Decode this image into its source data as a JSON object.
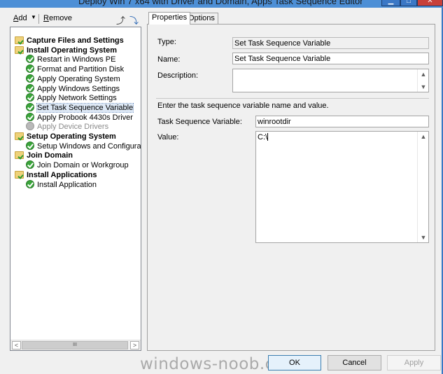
{
  "window": {
    "title": "Deploy Win 7 x64 with Driver and Domain, Apps Task Sequence Editor",
    "controls": [
      "minimize-icon",
      "maximize-icon",
      "close-icon"
    ]
  },
  "toolbar": {
    "add_label": "Add",
    "remove_label": "Remove"
  },
  "tree": {
    "items": [
      {
        "label": "Capture Files and Settings",
        "type": "group"
      },
      {
        "label": "Install Operating System",
        "type": "group"
      },
      {
        "label": "Restart in Windows PE",
        "type": "step"
      },
      {
        "label": "Format and Partition Disk",
        "type": "step"
      },
      {
        "label": "Apply Operating System",
        "type": "step"
      },
      {
        "label": "Apply Windows Settings",
        "type": "step"
      },
      {
        "label": "Apply Network Settings",
        "type": "step"
      },
      {
        "label": "Set Task Sequence Variable",
        "type": "step",
        "selected": true
      },
      {
        "label": "Apply Probook 4430s Driver",
        "type": "step"
      },
      {
        "label": "Apply Device Drivers",
        "type": "step",
        "disabled": true
      },
      {
        "label": "Setup Operating System",
        "type": "group"
      },
      {
        "label": "Setup Windows and Configuration",
        "type": "step"
      },
      {
        "label": "Join Domain",
        "type": "group"
      },
      {
        "label": "Join Domain or Workgroup",
        "type": "step"
      },
      {
        "label": "Install Applications",
        "type": "group"
      },
      {
        "label": "Install Application",
        "type": "step"
      }
    ],
    "scroll_thumb_glyph": "III"
  },
  "tabs": [
    {
      "label": "Properties",
      "active": true
    },
    {
      "label": "Options",
      "active": false
    }
  ],
  "properties": {
    "type_label": "Type:",
    "type_value": "Set Task Sequence Variable",
    "name_label": "Name:",
    "name_value": "Set Task Sequence Variable",
    "description_label": "Description:",
    "description_value": "",
    "instruction": "Enter the task sequence variable name and value.",
    "variable_label": "Task Sequence Variable:",
    "variable_value": "winrootdir",
    "value_label": "Value:",
    "value_value": "C:\\"
  },
  "buttons": {
    "ok": "OK",
    "cancel": "Cancel",
    "apply": "Apply"
  },
  "watermark": "windows-noob.com"
}
